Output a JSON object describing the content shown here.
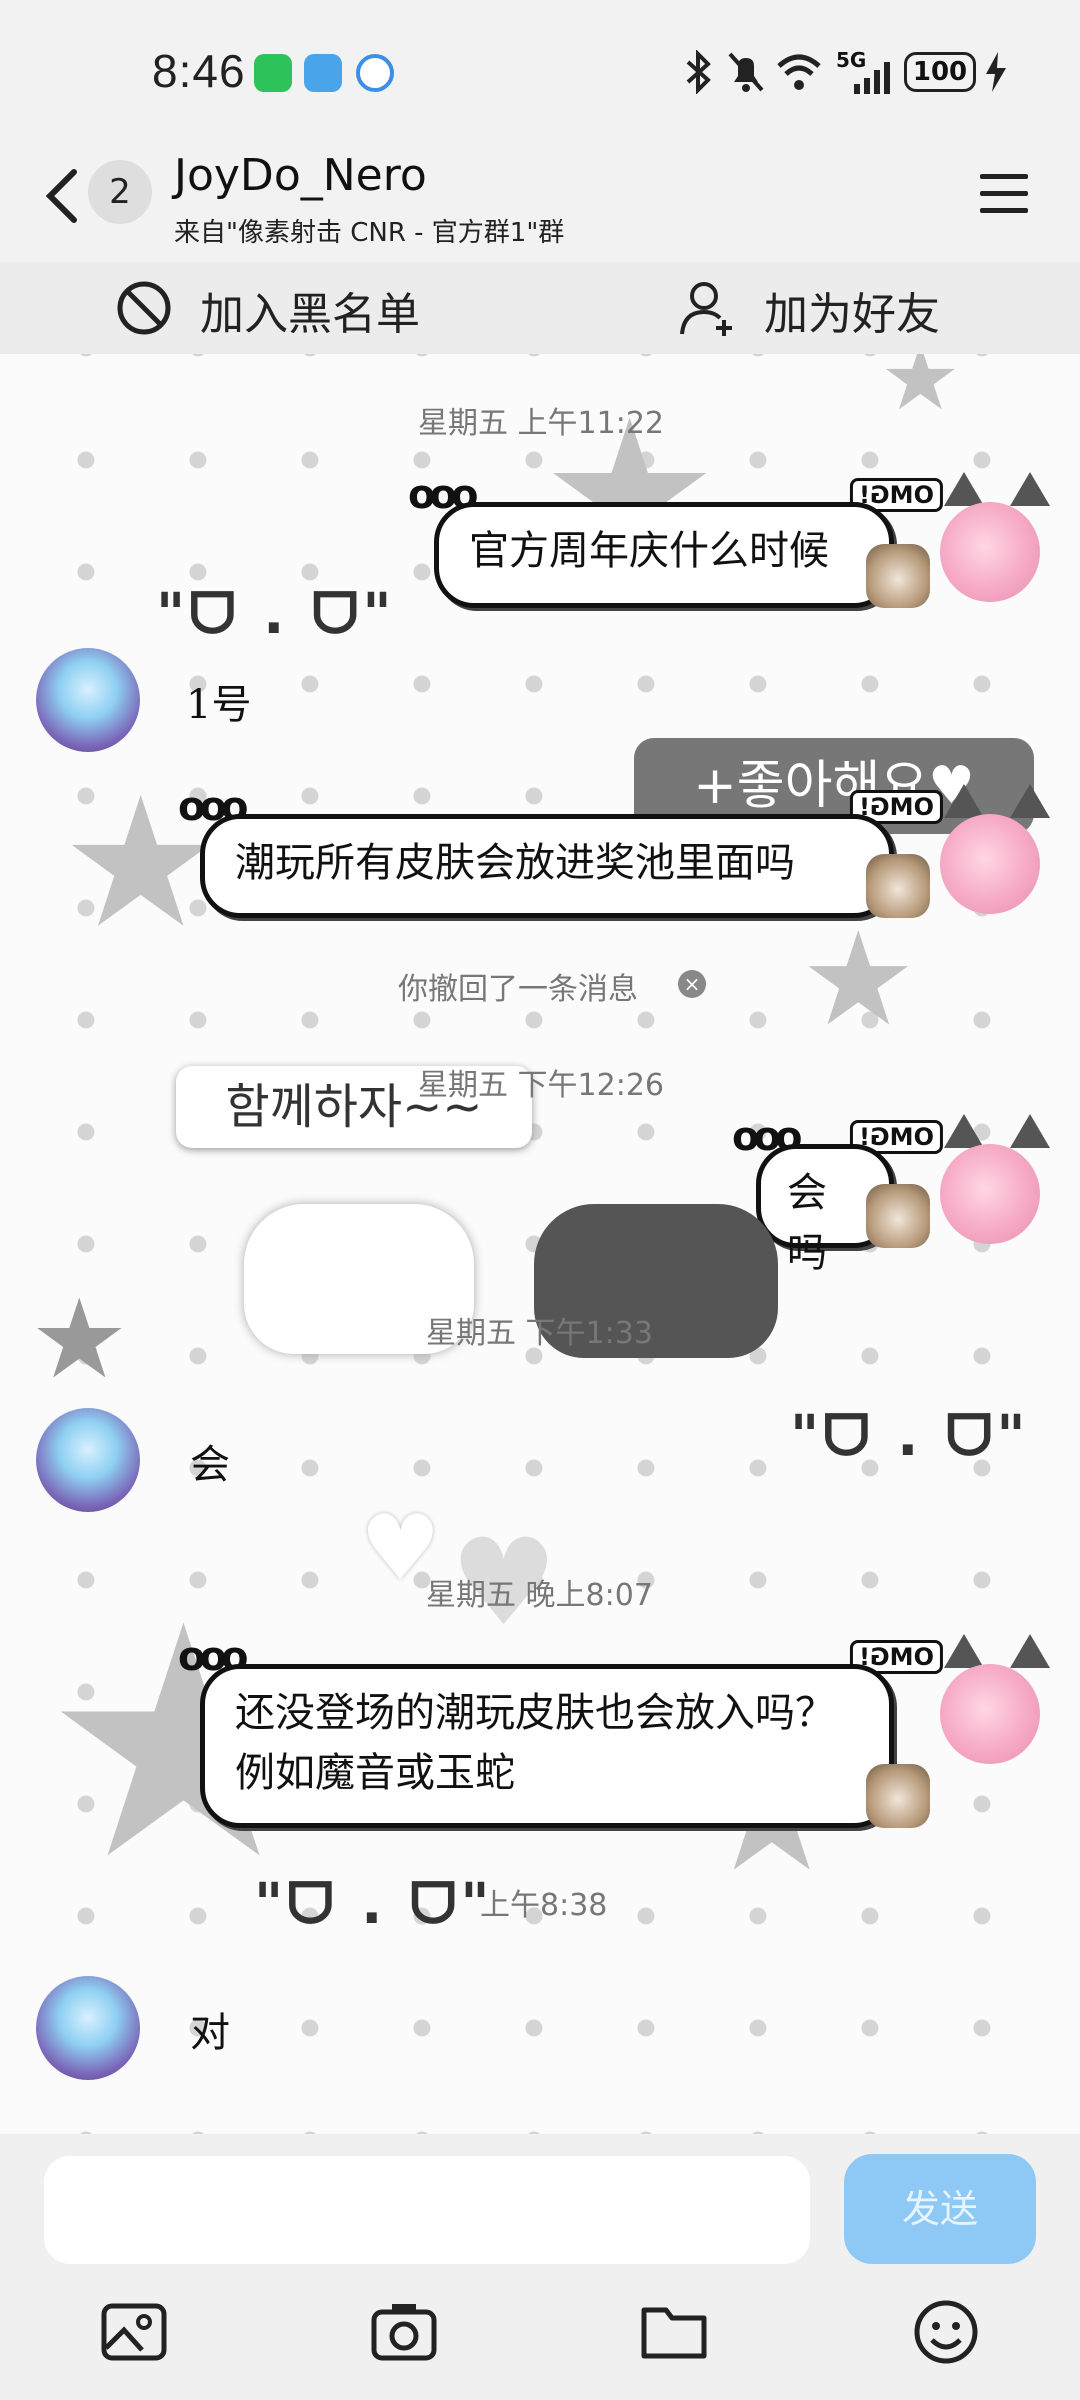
{
  "status_bar": {
    "time": "8:46",
    "network": "5G",
    "battery": "100"
  },
  "header": {
    "back_badge": "2",
    "title": "JoyDo_Nero",
    "subtitle": "来自\"像素射击 CNR - 官方群1\"群"
  },
  "actions": {
    "blacklist": "加入黑名单",
    "add_friend": "加为好友"
  },
  "messages": {
    "ts1": "星期五 上午11:22",
    "msg1": "官方周年庆什么时候",
    "reply1": "1号",
    "sticker1": "+좋아해요♥",
    "msg2": "潮玩所有皮肤会放进奖池里面吗",
    "recall": "你撤回了一条消息",
    "ts2": "星期五 下午12:26",
    "sticker2": "함께하자~~",
    "msg3": "会吗",
    "ts3": "星期五 下午1:33",
    "reply2": "会",
    "ts4": "星期五 晚上8:07",
    "msg4": "还没登场的潮玩皮肤也会放入吗？例如魔音或玉蛇",
    "ts5": "上午8:38",
    "reply3": "对",
    "omg": "OMG!",
    "face": "\"ᗜ . ᗜ\""
  },
  "input": {
    "placeholder": "",
    "send": "发送"
  },
  "toolbar": [
    "image-icon",
    "camera-icon",
    "folder-icon",
    "emoji-icon"
  ],
  "colors": {
    "send_bg": "#8ec9f5",
    "chat_bg": "#fbfbfb"
  }
}
